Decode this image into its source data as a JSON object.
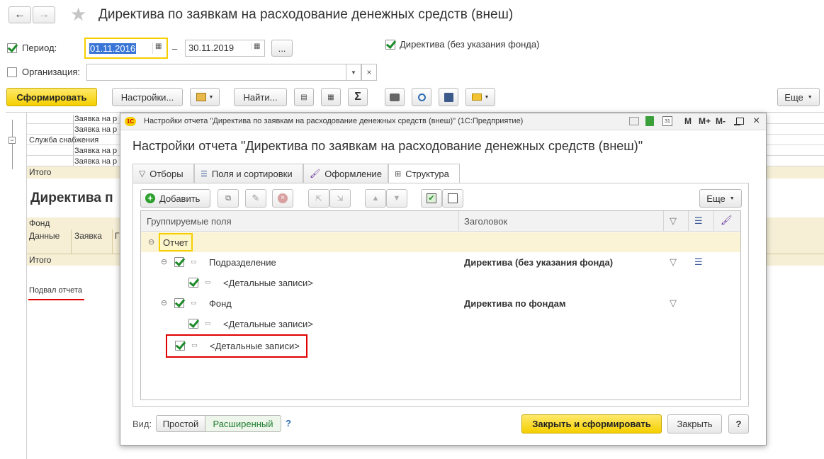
{
  "window": {
    "title": "Директива по заявкам на расходование денежных средств (внеш)"
  },
  "filters": {
    "period_label": "Период:",
    "period_from": "01.11.2016",
    "dash": "–",
    "period_to": "30.11.2019",
    "more_btn": "...",
    "directive_check_label": "Директива (без указания фонда)",
    "organization_label": "Организация:",
    "organization_value": "",
    "clear_btn": "×"
  },
  "toolbar": {
    "generate": "Сформировать",
    "settings": "Настройки...",
    "find": "Найти...",
    "sigma": "Σ",
    "more": "Еще"
  },
  "report": {
    "rows": [
      "Заявка на р",
      "Заявка на р",
      "Служба снабжения",
      "Заявка на р",
      "Заявка на р"
    ],
    "total1": "Итого",
    "heading": "Директива п",
    "fund_label": "Фонд",
    "col_data": "Данные",
    "col_request": "Заявка",
    "col_g": "Г",
    "total2": "Итого",
    "footer": "Подвал отчета"
  },
  "dialog": {
    "window_title": "Настройки отчета \"Директива по заявкам на расходование денежных средств (внеш)\"  (1С:Предприятие)",
    "heading": "Настройки отчета \"Директива по заявкам на расходование денежных средств (внеш)\"",
    "title_icons": [
      "M",
      "M+",
      "M-"
    ],
    "tabs": [
      "Отборы",
      "Поля и сортировки",
      "Оформление",
      "Структура"
    ],
    "add_btn": "Добавить",
    "more_btn": "Еще",
    "columns": {
      "fields": "Группируемые поля",
      "header": "Заголовок"
    },
    "tree": {
      "root": "Отчет",
      "subdivision": "Подразделение",
      "subdivision_title": "Директива (без указания фонда)",
      "detail1": "<Детальные записи>",
      "fund": "Фонд",
      "fund_title": "Директива по фондам",
      "detail2": "<Детальные записи>",
      "detail3": "<Детальные записи>"
    },
    "view_label": "Вид:",
    "view_simple": "Простой",
    "view_extended": "Расширенный",
    "help_q": "?",
    "close_generate": "Закрыть и сформировать",
    "close": "Закрыть",
    "help_btn": "?"
  },
  "colors": {
    "accent_yellow": "#f5cf00",
    "highlight_row": "#fbf3d5",
    "red_highlight": "#e00000",
    "check_green": "#1e8c2a"
  }
}
